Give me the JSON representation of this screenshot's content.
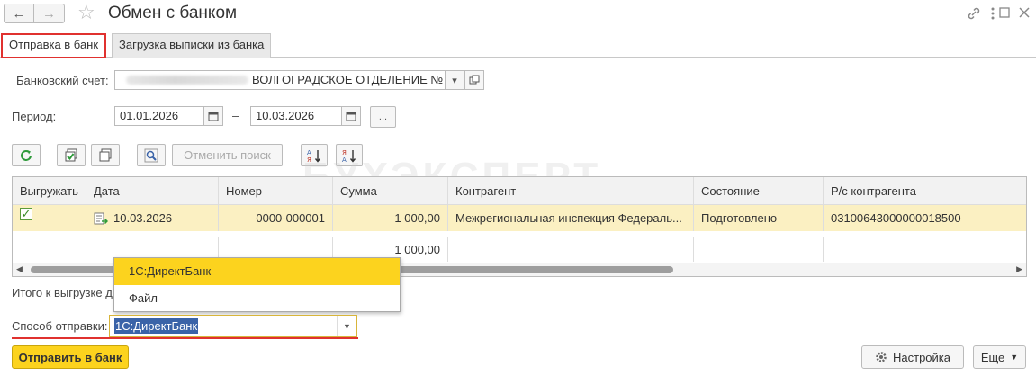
{
  "window": {
    "title": "Обмен с банком",
    "back_icon": "arrow-left-icon",
    "forward_icon": "arrow-right-icon",
    "favorite_icon": "star-icon",
    "link_icon": "link-icon",
    "menu_icon": "more-vertical-icon",
    "maximize_icon": "maximize-icon",
    "close_icon": "close-icon"
  },
  "tabs": [
    {
      "label": "Отправка в банк",
      "active": true
    },
    {
      "label": "Загрузка выписки из банка",
      "active": false
    }
  ],
  "form": {
    "bank_account_label": "Банковский счет:",
    "bank_account_value": "ВОЛГОГРАДСКОЕ ОТДЕЛЕНИЕ №",
    "period_label": "Период:",
    "period_from": "01.01.2026",
    "period_dash": "–",
    "period_to": "10.03.2026",
    "period_more": "..."
  },
  "toolbar": {
    "cancel_search_label": "Отменить поиск"
  },
  "table": {
    "columns": [
      "Выгружать",
      "Дата",
      "Номер",
      "Сумма",
      "Контрагент",
      "Состояние",
      "Р/с контрагента"
    ],
    "rows": [
      {
        "upload": true,
        "date": "10.03.2026",
        "number": "0000-000001",
        "amount": "1 000,00",
        "counterparty": "Межрегиональная инспекция Федераль...",
        "status": "Подготовлено",
        "account": "03100643000000018500"
      }
    ],
    "total_amount": "1 000,00"
  },
  "summary": {
    "total_label": "Итого к выгрузке д"
  },
  "dropdown": {
    "options": [
      "1С:ДиректБанк",
      "Файл"
    ],
    "highlighted": "1С:ДиректБанк"
  },
  "send_method": {
    "label": "Способ отправки:",
    "value": "1С:ДиректБанк"
  },
  "footer": {
    "send_label": "Отправить в банк",
    "settings_label": "Настройка",
    "more_label": "Еще"
  },
  "watermark": "БУХЭКСПЕРТ",
  "colors": {
    "accent_yellow": "#fcd31e",
    "active_tab_border": "#e0312f",
    "selected_row": "#fbf0c2",
    "selection_blue": "#3a63a8"
  }
}
